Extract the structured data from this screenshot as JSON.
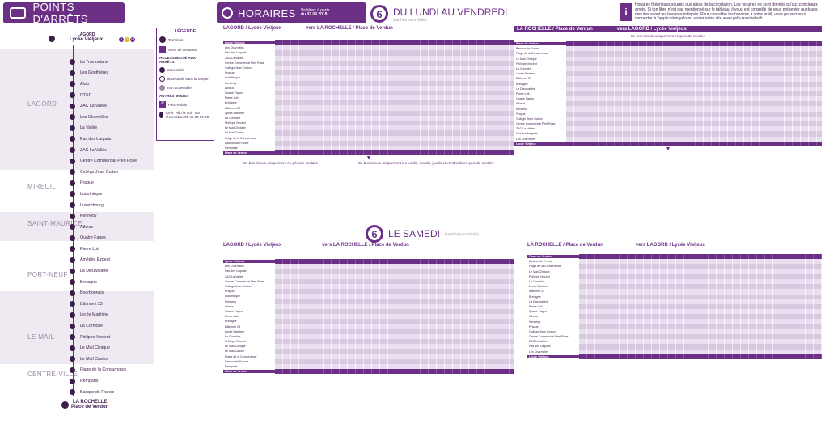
{
  "header": {
    "title_stops": "POINTS D'ARRÊTS",
    "title_schedules": "HORAIRES",
    "valid_from": "Valables à partir",
    "valid_date": "du 02.09.2018",
    "weekdays_number": "6",
    "weekdays_label": "DU LUNDI AU VENDREDI",
    "weekdays_sub": "(sauf les jours fériés)",
    "info_text": "Horaires théoriques soumis aux aléas de la circulation. Les horaires ne sont donnés qu'aux principaux arrêts. Si ton libre n'est pas mentionné sur le tableau, il vous est conseillé de vous présenter quelques minutes avant les horaires indiqués. Pour connaître les horaires à votre arrêt, vous pouvez vous connecter à l'application yelo ou visiter notre site www.yelo-larochelle.fr",
    "saturday_number": "6",
    "saturday_label": "LE SAMEDI",
    "saturday_sub": "(sauf les jours fériés)"
  },
  "line_terminals": {
    "top_zone": "LAGORD",
    "top_stop": "Lycée Vieljeux",
    "bottom_zone": "LA ROCHELLE",
    "bottom_stop": "Place de Verdun"
  },
  "zones": [
    "LAGORD",
    "MIREUIL",
    "SAINT-MAURICE",
    "PORT-NEUF",
    "LA ROCHELLE",
    "LE MAIL",
    "CENTRE-VILLE"
  ],
  "stops": [
    "La Tramontane",
    "Les Gonthières",
    "Alzio",
    "RTCR",
    "ZAC La Vallée",
    "Les Charmilles",
    "La Vallée",
    "Pas des Laquais",
    "ZAC La Vallée",
    "Centre Commercial Pierl Rose",
    "Collège Jean Guiton",
    "Prague",
    "Ludothèque",
    "Luxembourg",
    "Kennedy",
    "Atheus",
    "Quatre Fages",
    "Pierre Loti",
    "Amédée Ezpeut",
    "La Dieuwallère",
    "Bretagne",
    "Bourbonnais",
    "Bâtiment 23",
    "Lycée Maritime",
    "La Corniche",
    "Philippe Vincent",
    "Le Mail Clinique",
    "Le Mail Casino",
    "Plage de la Concurrence",
    "Remparts",
    "Basque de France"
  ],
  "legend": {
    "title": "LÉGENDE",
    "items": [
      "Terminus",
      "Sens de desserte",
      "ACCESSIBILITÉ AUX ARRÊTS",
      "accessible",
      "accessible sans la rampe",
      "non accessible",
      "AUTRES MODES",
      "Parc Relais",
      "Arrêt \"Allo la nuit\" sur réservation 05 46 00 59 00"
    ]
  },
  "tables": [
    {
      "title": "LAGORD / Lycée Vieljeux",
      "dest": "vers LA ROCHELLE / Place de Verdun",
      "note": "Ce bus circule uniquement en période scolaire"
    },
    {
      "title": "LA ROCHELLE / Place de Verdun",
      "dest": "vers LAGORD / Lycée Vieljeux",
      "note": "Ce bus circule uniquement en période scolaire"
    },
    {
      "title": "LAGORD / Lycée Vieljeux",
      "dest": "vers LA ROCHELLE / Place de Verdun",
      "note": ""
    },
    {
      "title": "LA ROCHELLE / Place de Verdun",
      "dest": "vers LAGORD / Lycée Vieljeux",
      "note": ""
    }
  ],
  "table_rows_down": [
    "Lycée Vieljeux",
    "Les Charmilles",
    "Pas des Laquais",
    "ZAC La Vallée",
    "Centre Commercial Pierl Rose",
    "Collège Jean Guiton",
    "Prague",
    "Ludothèque",
    "Kennedy",
    "Atheus",
    "Quatre Fages",
    "Pierre Loti",
    "Bretagne",
    "Bâtiment 23",
    "Lycée Maritime",
    "La Corniche",
    "Philippe Vincent",
    "Le Mail Clinique",
    "Le Mail Casino",
    "Plage de la Concurrence",
    "Basque de France",
    "Remparts",
    "Place de Verdun"
  ],
  "table_rows_up": [
    "Place de Verdun",
    "Basque de France",
    "Plage de la Concurrence",
    "Le Mail Clinique",
    "Philippe Vincent",
    "La Corniche",
    "Lycée Maritime",
    "Bâtiment 23",
    "Bretagne",
    "La Dieuwallère",
    "Pierre Loti",
    "Quatre Fages",
    "Atheus",
    "Kennedy",
    "Prague",
    "Collège Jean Guiton",
    "Centre Commercial Pierl Rose",
    "ZAC La Vallée",
    "Pas des Laquais",
    "Les Charmilles",
    "Lycée Vieljeux"
  ],
  "foot_notes": {
    "school_only": "Ce bus circule uniquement en période scolaire",
    "special": "Ce bus circule uniquement les lundis, mardis, jeudis et vendredis en période scolaire"
  },
  "colors": {
    "primary": "#6b2f86",
    "yellow": "#d6b50a",
    "magenta": "#c7217f"
  }
}
